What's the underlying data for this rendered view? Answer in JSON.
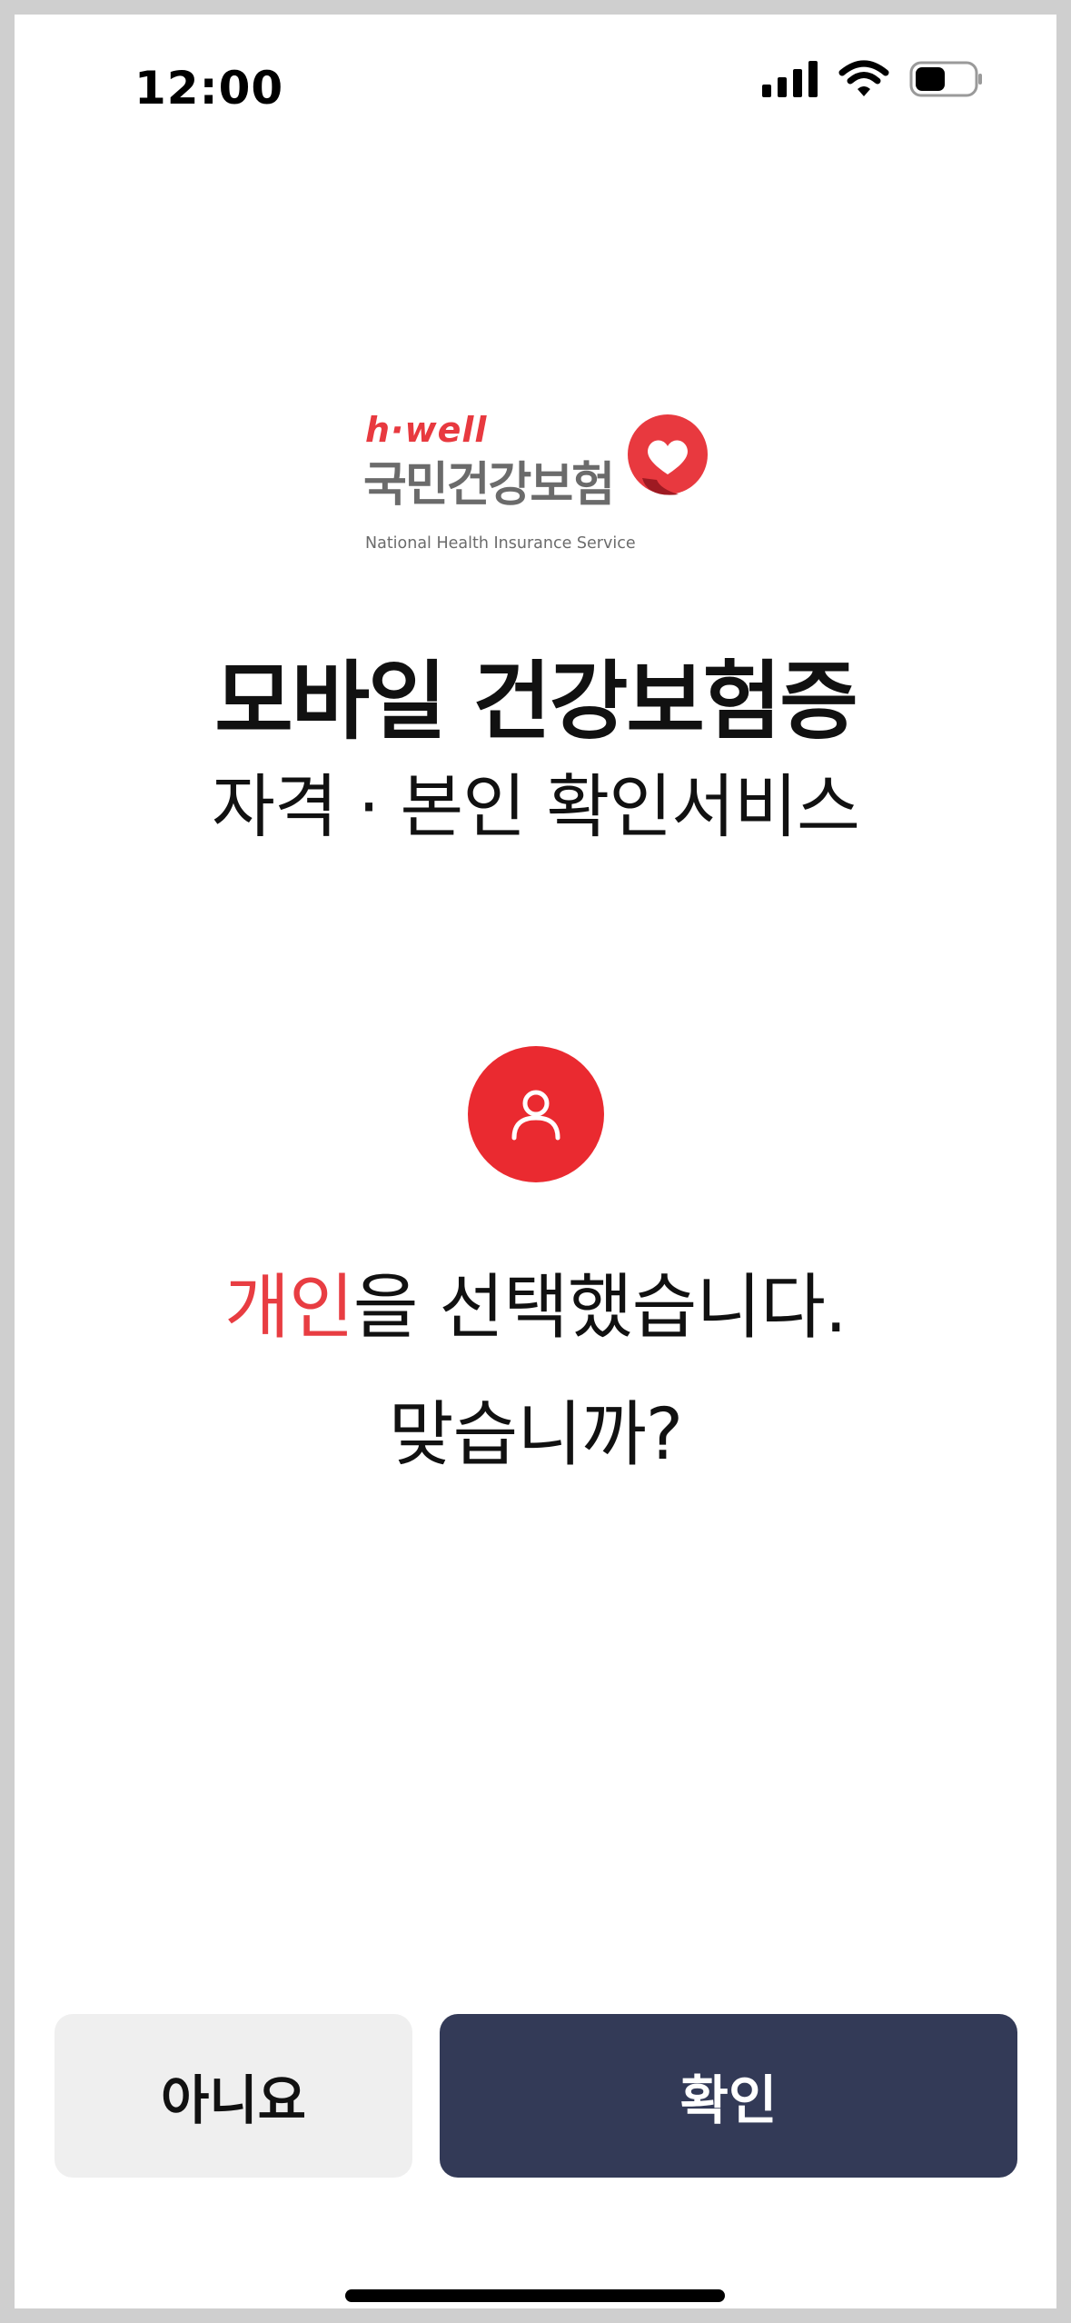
{
  "status_bar": {
    "time": "12:00"
  },
  "logo": {
    "brand": "h·well",
    "org_name": "국민건강보험",
    "english_name": "National Health Insurance Service"
  },
  "header": {
    "title": "모바일 건강보험증",
    "subtitle": "자격 · 본인 확인서비스"
  },
  "confirmation": {
    "selected_type": "개인",
    "message_suffix": "을 선택했습니다.",
    "question": "맞습니까?"
  },
  "buttons": {
    "no_label": "아니요",
    "confirm_label": "확인"
  },
  "colors": {
    "accent_red": "#ea2a30",
    "confirm_button": "#333a57",
    "no_button": "#efefef"
  }
}
